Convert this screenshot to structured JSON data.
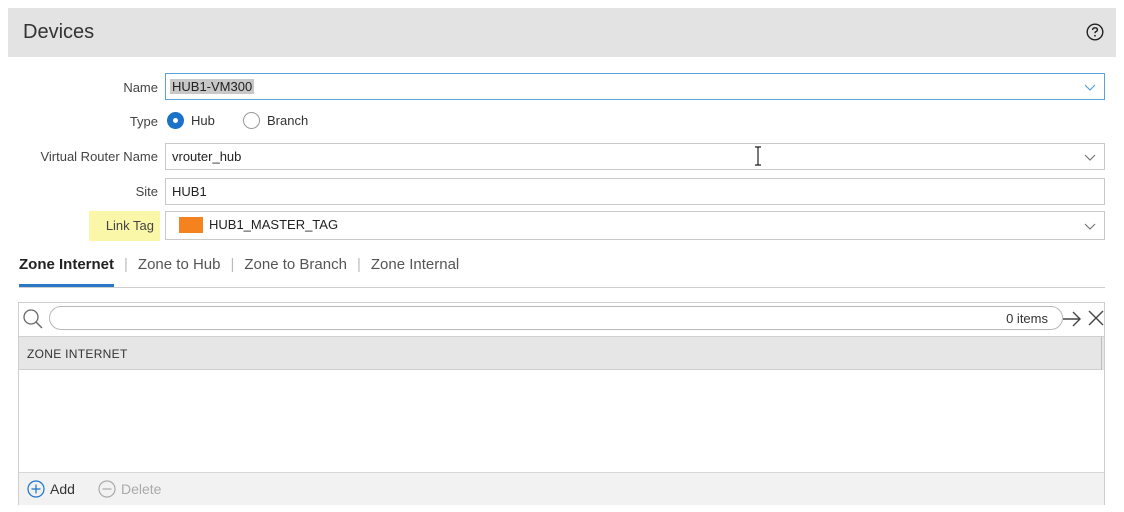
{
  "dialog": {
    "title": "Devices",
    "help_icon": "question-circle-icon"
  },
  "form": {
    "name": {
      "label": "Name",
      "value": "HUB1-VM300"
    },
    "type": {
      "label": "Type",
      "options": [
        {
          "label": "Hub",
          "selected": true
        },
        {
          "label": "Branch",
          "selected": false
        }
      ]
    },
    "virtual_router": {
      "label": "Virtual Router Name",
      "value": "vrouter_hub"
    },
    "site": {
      "label": "Site",
      "value": "HUB1"
    },
    "link_tag": {
      "label": "Link Tag",
      "value": "HUB1_MASTER_TAG",
      "color": "#f3821f"
    }
  },
  "tabs": [
    {
      "label": "Zone Internet",
      "active": true
    },
    {
      "label": "Zone to Hub",
      "active": false
    },
    {
      "label": "Zone to Branch",
      "active": false
    },
    {
      "label": "Zone Internal",
      "active": false
    }
  ],
  "grid": {
    "count_label": "0 items",
    "column_header": "ZONE INTERNET",
    "rows": []
  },
  "footer": {
    "add_label": "Add",
    "delete_label": "Delete"
  },
  "colors": {
    "accent": "#1a73c9",
    "tab_underline": "#2a78c5",
    "highlight": "#fbf7a9"
  }
}
